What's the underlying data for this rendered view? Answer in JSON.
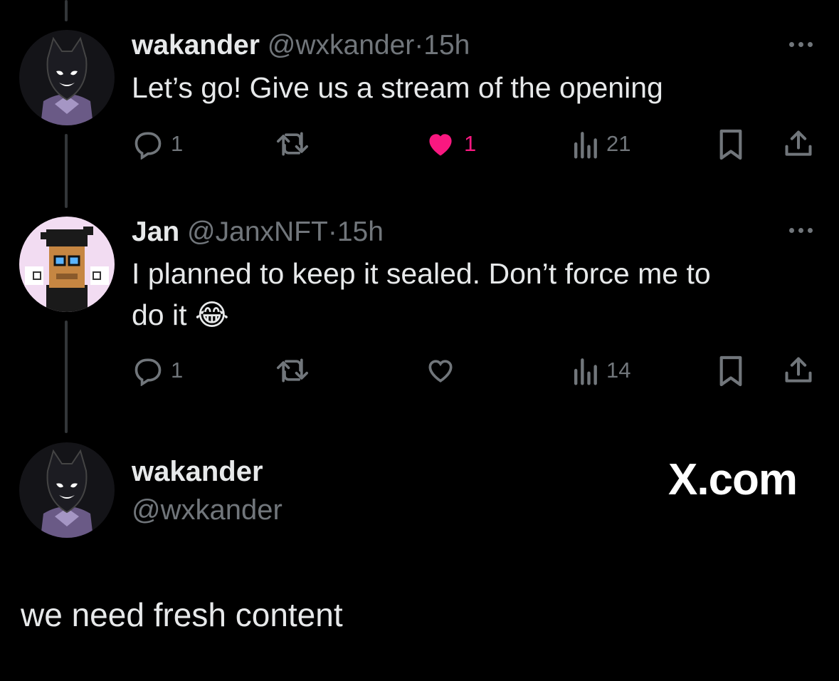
{
  "colors": {
    "background": "#000000",
    "text": "#e7e9ea",
    "muted": "#71767b",
    "like": "#f91880",
    "thread_line": "#333639"
  },
  "tweets": [
    {
      "name": "wakander",
      "handle": "@wxkander",
      "separator": "·",
      "time": "15h",
      "text_lines": [
        "Let’s go! Give us a stream of the opening"
      ],
      "avatar_icon": "panther-mask-avatar",
      "actions": {
        "reply_count": "1",
        "retweet_count": "",
        "like_count": "1",
        "liked": true,
        "views_count": "21"
      }
    },
    {
      "name": "Jan",
      "handle": "@JanxNFT",
      "separator": "·",
      "time": "15h",
      "text_lines": [
        "I planned to keep it sealed. Don’t force me to",
        "do it 😂"
      ],
      "avatar_icon": "pixel-ape-avatar",
      "actions": {
        "reply_count": "1",
        "retweet_count": "",
        "like_count": "",
        "liked": false,
        "views_count": "14"
      }
    }
  ],
  "card": {
    "name": "wakander",
    "handle": "@wxkander",
    "brand": "X.com",
    "avatar_icon": "panther-mask-avatar"
  },
  "bottom_caption": "we need fresh content"
}
